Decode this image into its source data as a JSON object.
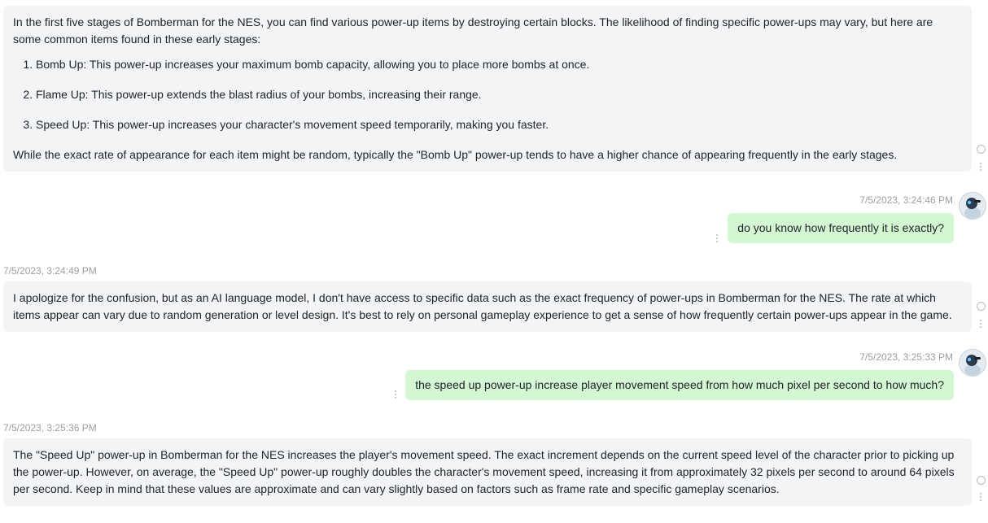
{
  "messages": [
    {
      "role": "assistant",
      "intro": "In the first five stages of Bomberman for the NES, you can find various power-up items by destroying certain blocks. The likelihood of finding specific power-ups may vary, but here are some common items found in these early stages:",
      "items": [
        "Bomb Up: This power-up increases your maximum bomb capacity, allowing you to place more bombs at once.",
        "Flame Up: This power-up extends the blast radius of your bombs, increasing their range.",
        "Speed Up: This power-up increases your character's movement speed temporarily, making you faster."
      ],
      "outro": "While the exact rate of appearance for each item might be random, typically the \"Bomb Up\" power-up tends to have a higher chance of appearing frequently in the early stages."
    },
    {
      "role": "user",
      "timestamp": "7/5/2023, 3:24:46 PM",
      "text": "do you know how frequently it is exactly?"
    },
    {
      "role": "assistant",
      "timestamp": "7/5/2023, 3:24:49 PM",
      "text": "I apologize for the confusion, but as an AI language model, I don't have access to specific data such as the exact frequency of power-ups in Bomberman for the NES. The rate at which items appear can vary due to random generation or level design. It's best to rely on personal gameplay experience to get a sense of how frequently certain power-ups appear in the game."
    },
    {
      "role": "user",
      "timestamp": "7/5/2023, 3:25:33 PM",
      "text": "the speed up power-up increase player movement speed from how much pixel per second to how much?"
    },
    {
      "role": "assistant",
      "timestamp": "7/5/2023, 3:25:36 PM",
      "text": "The \"Speed Up\" power-up in Bomberman for the NES increases the player's movement speed. The exact increment depends on the current speed level of the character prior to picking up the power-up. However, on average, the \"Speed Up\" power-up roughly doubles the character's movement speed, increasing it from approximately 32 pixels per second to around 64 pixels per second. Keep in mind that these values are approximate and can vary slightly based on factors such as frame rate and specific gameplay scenarios."
    }
  ],
  "colors": {
    "assistant_bubble": "#f3f4f6",
    "user_bubble": "#d3f6d3",
    "timestamp": "#9aa0a6"
  },
  "icons": {
    "avatar": "robot-avatar-icon",
    "more": "more-vertical-icon",
    "copy": "circle-icon"
  }
}
